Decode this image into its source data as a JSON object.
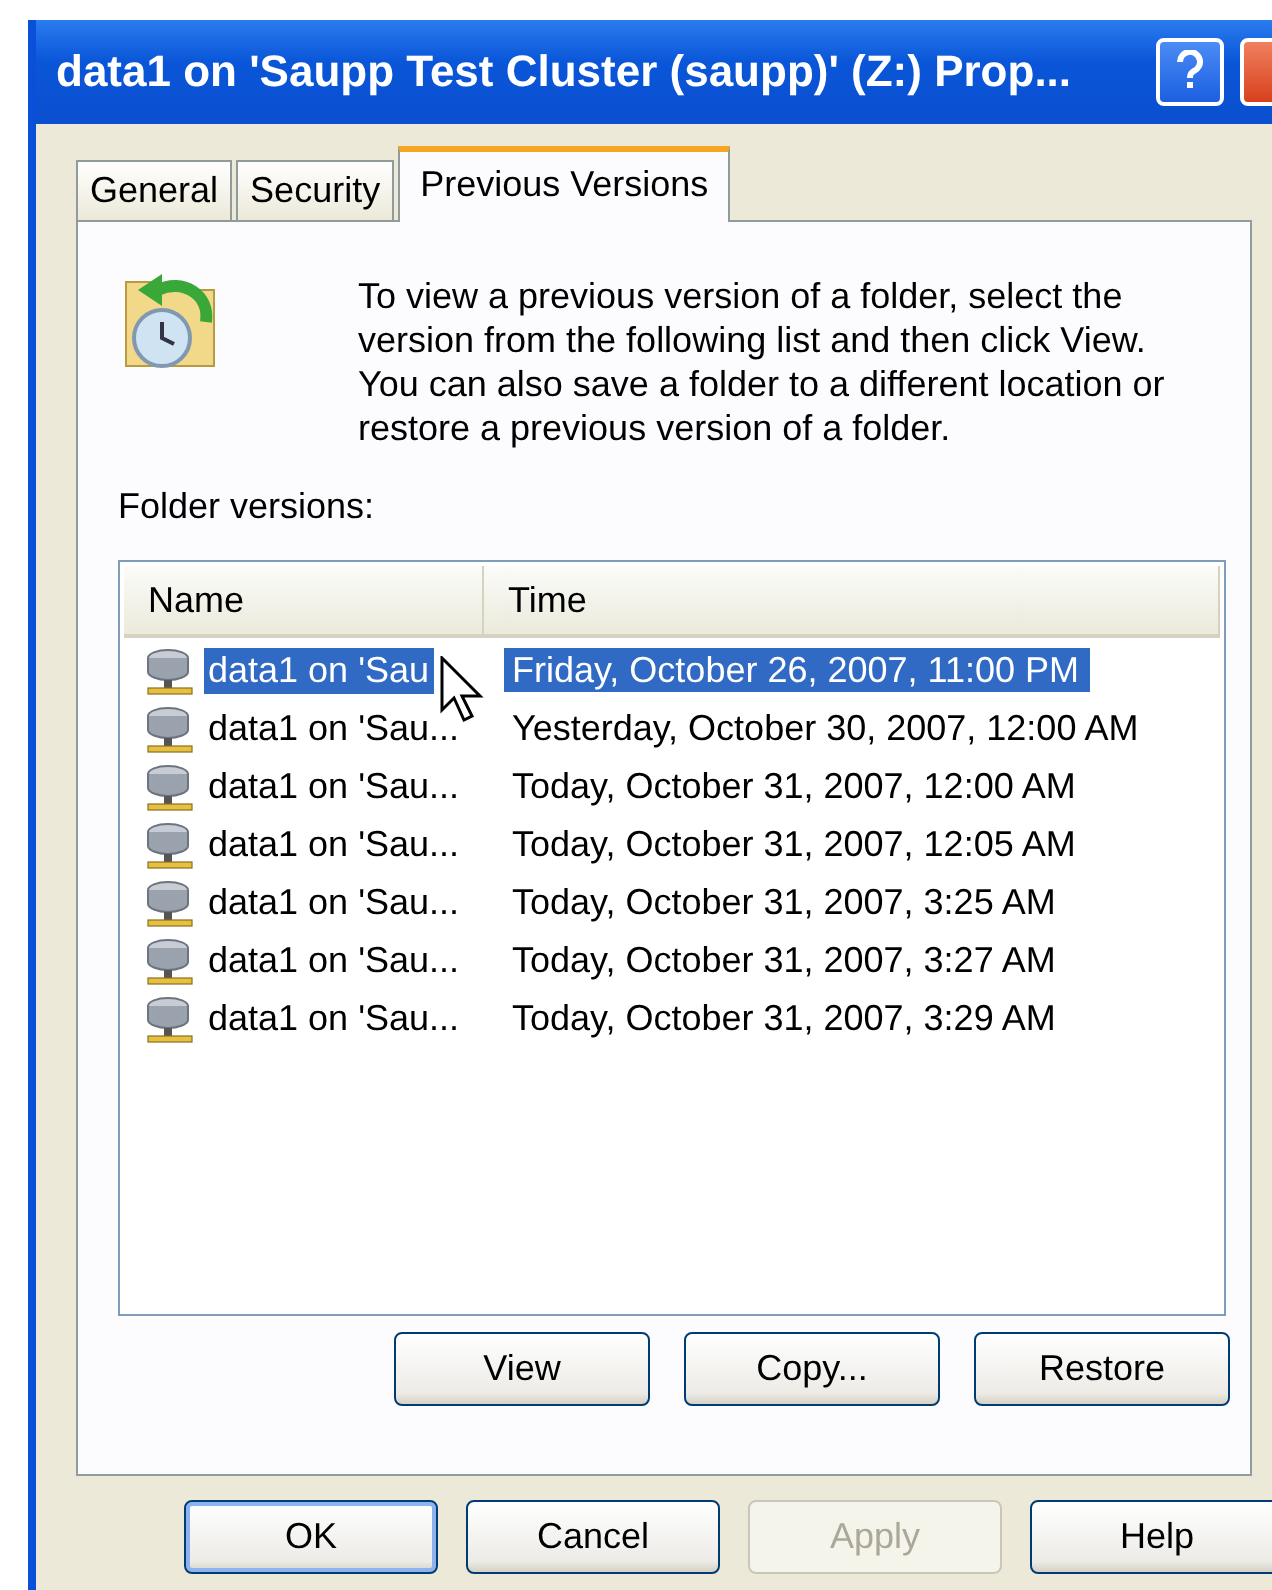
{
  "window": {
    "title": "data1 on 'Saupp Test Cluster (saupp)' (Z:) Prop..."
  },
  "tabs": [
    {
      "label": "General",
      "selected": false
    },
    {
      "label": "Security",
      "selected": false
    },
    {
      "label": "Previous Versions",
      "selected": true
    }
  ],
  "intro": "To view a previous version of a folder, select the version from the following list and then click View. You can also save a folder to a different location or restore a previous version of a folder.",
  "list_label": "Folder versions:",
  "table": {
    "columns": [
      "Name",
      "Time"
    ],
    "rows": [
      {
        "name": "data1 on 'Sau",
        "time": "Friday, October 26, 2007, 11:00 PM",
        "selected": true
      },
      {
        "name": "data1 on 'Sau...",
        "time": "Yesterday, October 30, 2007, 12:00 AM",
        "selected": false
      },
      {
        "name": "data1 on 'Sau...",
        "time": "Today, October 31, 2007, 12:00 AM",
        "selected": false
      },
      {
        "name": "data1 on 'Sau...",
        "time": "Today, October 31, 2007, 12:05 AM",
        "selected": false
      },
      {
        "name": "data1 on 'Sau...",
        "time": "Today, October 31, 2007, 3:25 AM",
        "selected": false
      },
      {
        "name": "data1 on 'Sau...",
        "time": "Today, October 31, 2007, 3:27 AM",
        "selected": false
      },
      {
        "name": "data1 on 'Sau...",
        "time": "Today, October 31, 2007, 3:29 AM",
        "selected": false
      }
    ]
  },
  "version_buttons": [
    {
      "label": "View",
      "disabled": false
    },
    {
      "label": "Copy...",
      "disabled": false
    },
    {
      "label": "Restore",
      "disabled": false
    }
  ],
  "dialog_buttons": [
    {
      "label": "OK",
      "disabled": false,
      "default": true
    },
    {
      "label": "Cancel",
      "disabled": false,
      "default": false
    },
    {
      "label": "Apply",
      "disabled": true,
      "default": false
    },
    {
      "label": "Help",
      "disabled": false,
      "default": false
    }
  ]
}
